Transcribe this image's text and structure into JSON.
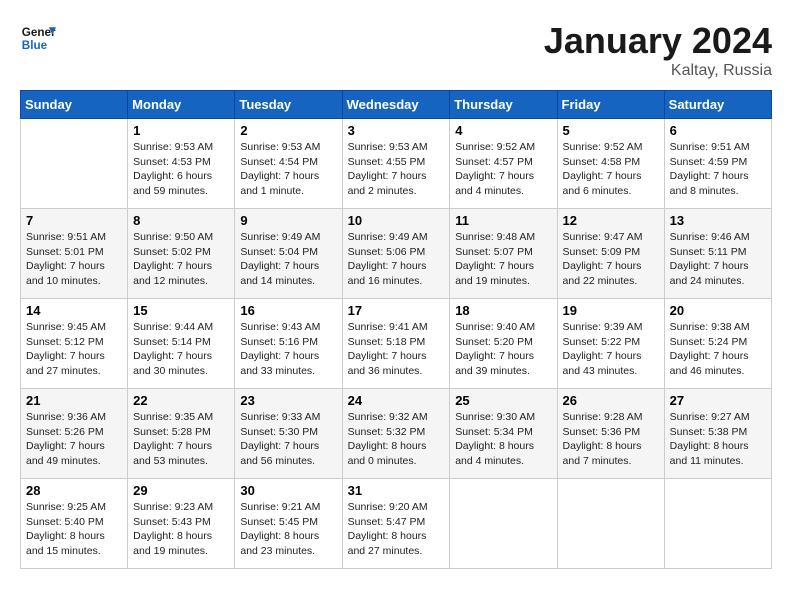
{
  "header": {
    "logo_line1": "General",
    "logo_line2": "Blue",
    "month_title": "January 2024",
    "location": "Kaltay, Russia"
  },
  "weekdays": [
    "Sunday",
    "Monday",
    "Tuesday",
    "Wednesday",
    "Thursday",
    "Friday",
    "Saturday"
  ],
  "weeks": [
    [
      {
        "day": "",
        "info": ""
      },
      {
        "day": "1",
        "info": "Sunrise: 9:53 AM\nSunset: 4:53 PM\nDaylight: 6 hours\nand 59 minutes."
      },
      {
        "day": "2",
        "info": "Sunrise: 9:53 AM\nSunset: 4:54 PM\nDaylight: 7 hours\nand 1 minute."
      },
      {
        "day": "3",
        "info": "Sunrise: 9:53 AM\nSunset: 4:55 PM\nDaylight: 7 hours\nand 2 minutes."
      },
      {
        "day": "4",
        "info": "Sunrise: 9:52 AM\nSunset: 4:57 PM\nDaylight: 7 hours\nand 4 minutes."
      },
      {
        "day": "5",
        "info": "Sunrise: 9:52 AM\nSunset: 4:58 PM\nDaylight: 7 hours\nand 6 minutes."
      },
      {
        "day": "6",
        "info": "Sunrise: 9:51 AM\nSunset: 4:59 PM\nDaylight: 7 hours\nand 8 minutes."
      }
    ],
    [
      {
        "day": "7",
        "info": "Sunrise: 9:51 AM\nSunset: 5:01 PM\nDaylight: 7 hours\nand 10 minutes."
      },
      {
        "day": "8",
        "info": "Sunrise: 9:50 AM\nSunset: 5:02 PM\nDaylight: 7 hours\nand 12 minutes."
      },
      {
        "day": "9",
        "info": "Sunrise: 9:49 AM\nSunset: 5:04 PM\nDaylight: 7 hours\nand 14 minutes."
      },
      {
        "day": "10",
        "info": "Sunrise: 9:49 AM\nSunset: 5:06 PM\nDaylight: 7 hours\nand 16 minutes."
      },
      {
        "day": "11",
        "info": "Sunrise: 9:48 AM\nSunset: 5:07 PM\nDaylight: 7 hours\nand 19 minutes."
      },
      {
        "day": "12",
        "info": "Sunrise: 9:47 AM\nSunset: 5:09 PM\nDaylight: 7 hours\nand 22 minutes."
      },
      {
        "day": "13",
        "info": "Sunrise: 9:46 AM\nSunset: 5:11 PM\nDaylight: 7 hours\nand 24 minutes."
      }
    ],
    [
      {
        "day": "14",
        "info": "Sunrise: 9:45 AM\nSunset: 5:12 PM\nDaylight: 7 hours\nand 27 minutes."
      },
      {
        "day": "15",
        "info": "Sunrise: 9:44 AM\nSunset: 5:14 PM\nDaylight: 7 hours\nand 30 minutes."
      },
      {
        "day": "16",
        "info": "Sunrise: 9:43 AM\nSunset: 5:16 PM\nDaylight: 7 hours\nand 33 minutes."
      },
      {
        "day": "17",
        "info": "Sunrise: 9:41 AM\nSunset: 5:18 PM\nDaylight: 7 hours\nand 36 minutes."
      },
      {
        "day": "18",
        "info": "Sunrise: 9:40 AM\nSunset: 5:20 PM\nDaylight: 7 hours\nand 39 minutes."
      },
      {
        "day": "19",
        "info": "Sunrise: 9:39 AM\nSunset: 5:22 PM\nDaylight: 7 hours\nand 43 minutes."
      },
      {
        "day": "20",
        "info": "Sunrise: 9:38 AM\nSunset: 5:24 PM\nDaylight: 7 hours\nand 46 minutes."
      }
    ],
    [
      {
        "day": "21",
        "info": "Sunrise: 9:36 AM\nSunset: 5:26 PM\nDaylight: 7 hours\nand 49 minutes."
      },
      {
        "day": "22",
        "info": "Sunrise: 9:35 AM\nSunset: 5:28 PM\nDaylight: 7 hours\nand 53 minutes."
      },
      {
        "day": "23",
        "info": "Sunrise: 9:33 AM\nSunset: 5:30 PM\nDaylight: 7 hours\nand 56 minutes."
      },
      {
        "day": "24",
        "info": "Sunrise: 9:32 AM\nSunset: 5:32 PM\nDaylight: 8 hours\nand 0 minutes."
      },
      {
        "day": "25",
        "info": "Sunrise: 9:30 AM\nSunset: 5:34 PM\nDaylight: 8 hours\nand 4 minutes."
      },
      {
        "day": "26",
        "info": "Sunrise: 9:28 AM\nSunset: 5:36 PM\nDaylight: 8 hours\nand 7 minutes."
      },
      {
        "day": "27",
        "info": "Sunrise: 9:27 AM\nSunset: 5:38 PM\nDaylight: 8 hours\nand 11 minutes."
      }
    ],
    [
      {
        "day": "28",
        "info": "Sunrise: 9:25 AM\nSunset: 5:40 PM\nDaylight: 8 hours\nand 15 minutes."
      },
      {
        "day": "29",
        "info": "Sunrise: 9:23 AM\nSunset: 5:43 PM\nDaylight: 8 hours\nand 19 minutes."
      },
      {
        "day": "30",
        "info": "Sunrise: 9:21 AM\nSunset: 5:45 PM\nDaylight: 8 hours\nand 23 minutes."
      },
      {
        "day": "31",
        "info": "Sunrise: 9:20 AM\nSunset: 5:47 PM\nDaylight: 8 hours\nand 27 minutes."
      },
      {
        "day": "",
        "info": ""
      },
      {
        "day": "",
        "info": ""
      },
      {
        "day": "",
        "info": ""
      }
    ]
  ]
}
